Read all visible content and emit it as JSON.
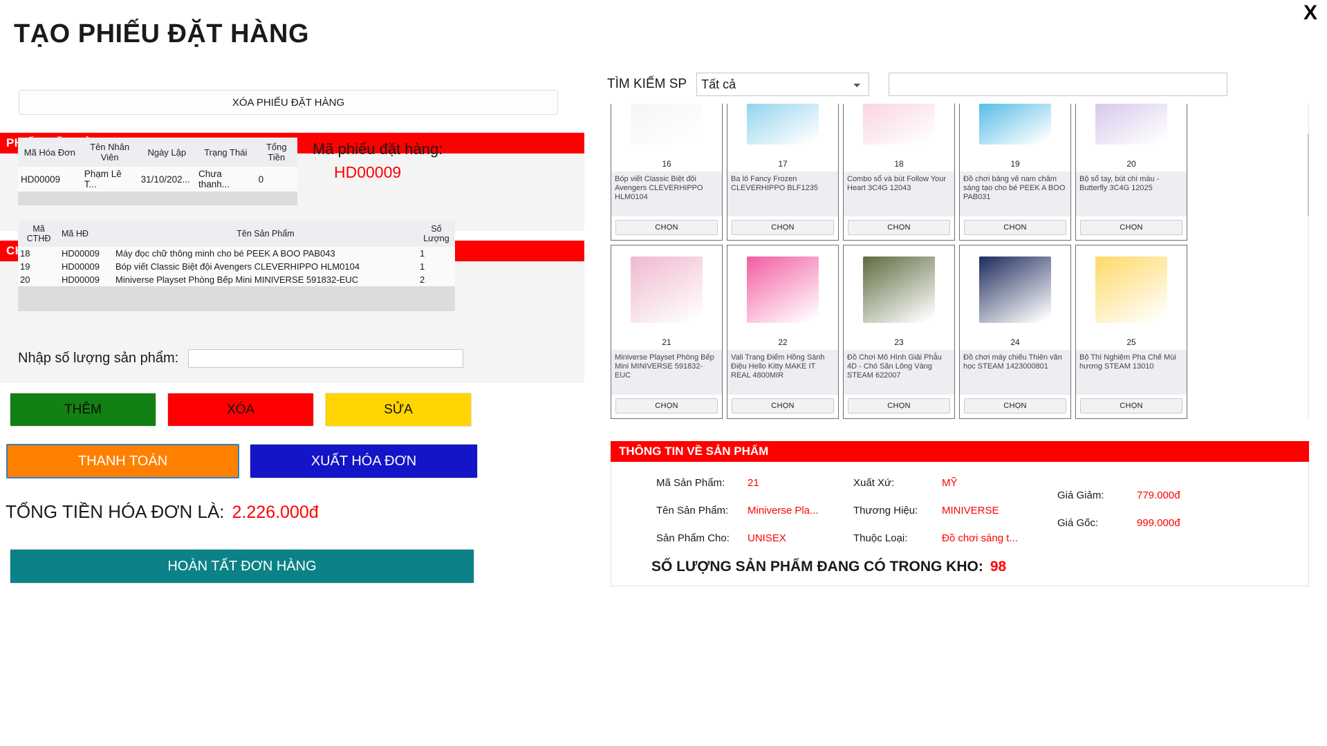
{
  "window": {
    "close_label": "X"
  },
  "header": {
    "title": "TẠO PHIẾU ĐẶT HÀNG"
  },
  "left": {
    "delete_order_button": "XÓA PHIẾU ĐẶT HÀNG",
    "order_section_title": "PHIẾU ĐẶT HÀNG",
    "detail_section_title": "CHI TIẾT PHIẾU ĐẶT HÀNG",
    "order_table": {
      "headers": [
        "Mã Hóa Đơn",
        "Tên Nhân Viên",
        "Ngày Lập",
        "Trạng Thái",
        "Tổng Tiền"
      ],
      "rows": [
        [
          "HD00009",
          "Phạm Lê T...",
          "31/10/202...",
          "Chưa thanh...",
          "0"
        ]
      ]
    },
    "ma_phieu_label": "Mã phiếu đặt hàng:",
    "ma_phieu_value": "HD00009",
    "detail_table": {
      "headers": [
        "Mã CTHĐ",
        "Mã HĐ",
        "Tên Sản Phẩm",
        "Số Lượng"
      ],
      "rows": [
        [
          "18",
          "HD00009",
          "Máy đọc chữ thông minh cho bé PEEK A BOO PAB043",
          "1"
        ],
        [
          "19",
          "HD00009",
          "Bóp viết Classic Biệt đội Avengers CLEVERHIPPO HLM0104",
          "1"
        ],
        [
          "20",
          "HD00009",
          "Miniverse Playset Phòng Bếp Mini MINIVERSE 591832-EUC",
          "2"
        ]
      ]
    },
    "qty_label": "Nhập số lượng sản phẩm:",
    "qty_value": "",
    "qty_placeholder": "",
    "buttons": {
      "add": "THÊM",
      "delete": "XÓA",
      "edit": "SỬA",
      "pay": "THANH TOÁN",
      "export": "XUẤT HÓA ĐƠN",
      "finish": "HOÀN TẤT ĐƠN HÀNG"
    },
    "total_label": "TỔNG TIỀN HÓA ĐƠN LÀ:",
    "total_value": "2.226.000đ"
  },
  "right": {
    "search_label": "TÌM KIẾM SP",
    "search_select_value": "Tất cả",
    "search_select_options": [
      "Tất cả"
    ],
    "search_input_value": "",
    "search_input_placeholder": "",
    "choose_label": "CHỌN",
    "products": [
      {
        "id": "16",
        "name": "Bóp viết Classic Biệt đội Avengers CLEVERHIPPO HLM0104",
        "swatch": "#f4f2f0"
      },
      {
        "id": "17",
        "name": "Ba lô Fancy Frozen CLEVERHIPPO BLF1235",
        "swatch": "#6ec6e8"
      },
      {
        "id": "18",
        "name": "Combo sổ và bút Follow Your Heart 3C4G 12043",
        "swatch": "#f8c6d8"
      },
      {
        "id": "19",
        "name": "Đồ chơi bảng vẽ nam châm sáng tạo cho bé PEEK A BOO PAB031",
        "swatch": "#1ea7dd"
      },
      {
        "id": "20",
        "name": "Bộ sổ tay, bút chì màu - Butterfly 3C4G 12025",
        "swatch": "#c9b6e4"
      },
      {
        "id": "21",
        "name": "Miniverse Playset Phòng Bếp Mini MINIVERSE 591832-EUC",
        "swatch": "#f0b8cf"
      },
      {
        "id": "22",
        "name": "Vali Trang Điểm Hồng Sành Điệu Hello Kitty MAKE IT REAL 4800MIR",
        "swatch": "#f25ca2"
      },
      {
        "id": "23",
        "name": "Đồ Chơi Mô Hình Giải Phẫu 4D - Chó Săn Lông Vàng STEAM 622007",
        "swatch": "#5d6b3f"
      },
      {
        "id": "24",
        "name": "Đồ chơi máy chiếu Thiên văn học STEAM 1423000801",
        "swatch": "#1d2b5c"
      },
      {
        "id": "25",
        "name": "Bộ Thí Nghiệm Pha Chế Mùi hương STEAM 13010",
        "swatch": "#ffd966"
      },
      {
        "id": "26",
        "name": "",
        "swatch": "#9fe0a0"
      },
      {
        "id": "27",
        "name": "",
        "swatch": "#e8b23c"
      },
      {
        "id": "28",
        "name": "",
        "swatch": "#e86bb0"
      },
      {
        "id": "29",
        "name": "",
        "swatch": "#cfd8e8"
      },
      {
        "id": "30",
        "name": "",
        "swatch": "#f39ac2"
      }
    ],
    "info": {
      "section_title": "THÔNG TIN VỀ SẢN PHẨM",
      "fields": [
        {
          "label": "Mã Sản Phẩm:",
          "value": "21"
        },
        {
          "label": "Tên Sản Phẩm:",
          "value": "Miniverse Pla..."
        },
        {
          "label": "Sản Phẩm Cho:",
          "value": "UNISEX"
        },
        {
          "label": "Xuất Xứ:",
          "value": "MỸ"
        },
        {
          "label": "Thương Hiệu:",
          "value": "MINIVERSE"
        },
        {
          "label": "Thuộc Loại:",
          "value": "Đồ chơi sáng t..."
        },
        {
          "label": "Giá Giảm:",
          "value": "779.000đ"
        },
        {
          "label": "Giá Gốc:",
          "value": "999.000đ"
        }
      ],
      "stock_label": "SỐ LƯỢNG SẢN PHẨM ĐANG CÓ TRONG KHO:",
      "stock_value": "98"
    }
  }
}
